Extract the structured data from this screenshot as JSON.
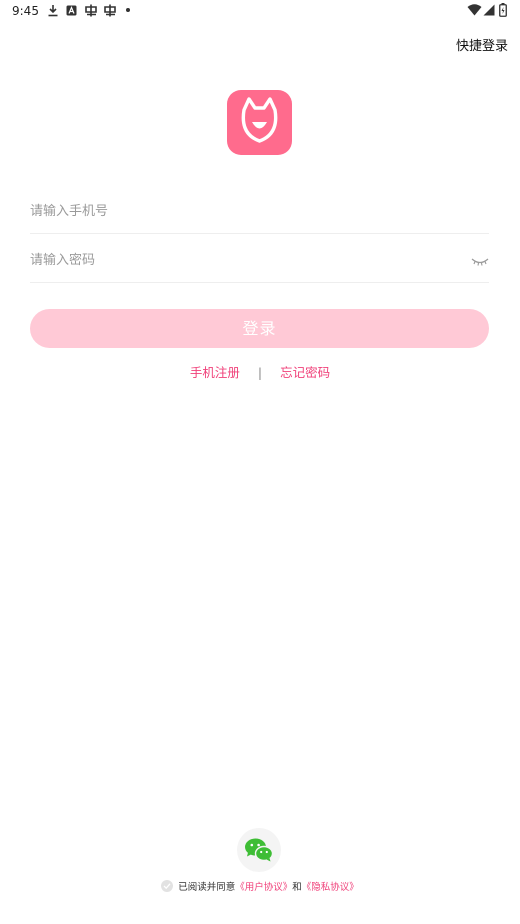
{
  "status_bar": {
    "time": "9:45"
  },
  "header": {
    "quick_login_label": "快捷登录"
  },
  "form": {
    "phone_placeholder": "请输入手机号",
    "password_placeholder": "请输入密码",
    "login_label": "登录"
  },
  "links": {
    "register_label": "手机注册",
    "separator": "|",
    "forgot_label": "忘记密码"
  },
  "agreement": {
    "prefix": "已阅读并同意",
    "user_agreement": "《用户协议》",
    "and": "和",
    "privacy_policy": "《隐私协议》"
  },
  "colors": {
    "brand": "#ff6b8d",
    "login_button_disabled": "#ffc9d6",
    "link": "#f0417a",
    "wechat_green": "#3ebd35"
  },
  "icons": [
    "download-icon",
    "a-badge-icon",
    "sim-card-icon",
    "sim-card-icon",
    "dot-icon",
    "wifi-icon",
    "signal-icon",
    "battery-icon",
    "app-logo",
    "eye-closed-icon",
    "wechat-icon",
    "check-icon"
  ]
}
